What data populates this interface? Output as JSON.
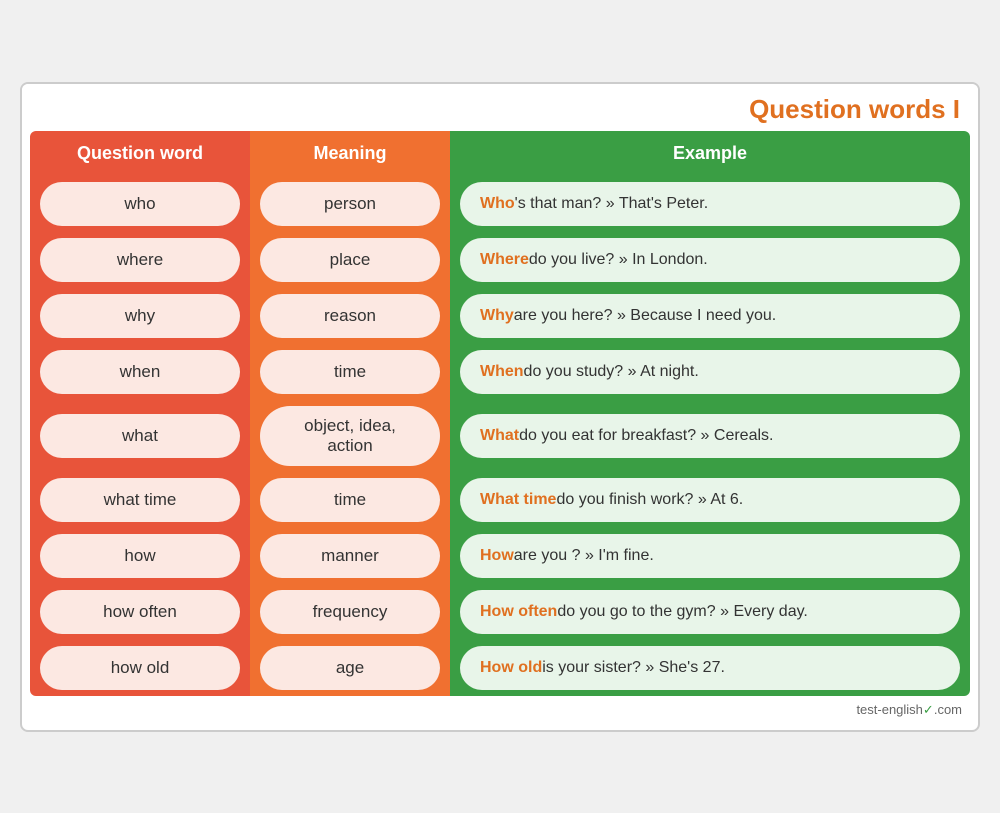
{
  "title": "Question words I",
  "columns": {
    "qword": "Question word",
    "meaning": "Meaning",
    "example": "Example"
  },
  "rows": [
    {
      "qword": "who",
      "meaning": "person",
      "highlight": "Who",
      "rest": "'s that man? » That's Peter."
    },
    {
      "qword": "where",
      "meaning": "place",
      "highlight": "Where",
      "rest": " do you live? » In London."
    },
    {
      "qword": "why",
      "meaning": "reason",
      "highlight": "Why",
      "rest": " are you here? » Because I need you."
    },
    {
      "qword": "when",
      "meaning": "time",
      "highlight": "When",
      "rest": " do you study? » At night."
    },
    {
      "qword": "what",
      "meaning": "object, idea, action",
      "highlight": "What",
      "rest": " do you eat for breakfast? » Cereals."
    },
    {
      "qword": "what time",
      "meaning": "time",
      "highlight": "What time",
      "rest": " do you finish work? » At 6."
    },
    {
      "qword": "how",
      "meaning": "manner",
      "highlight": "How",
      "rest": " are you ? » I'm fine."
    },
    {
      "qword": "how often",
      "meaning": "frequency",
      "highlight": "How often",
      "rest": " do you go to the gym? » Every day."
    },
    {
      "qword": "how old",
      "meaning": "age",
      "highlight": "How old",
      "rest": " is your sister? » She's 27."
    }
  ],
  "footer": "test-english",
  "footer_domain": ".com"
}
